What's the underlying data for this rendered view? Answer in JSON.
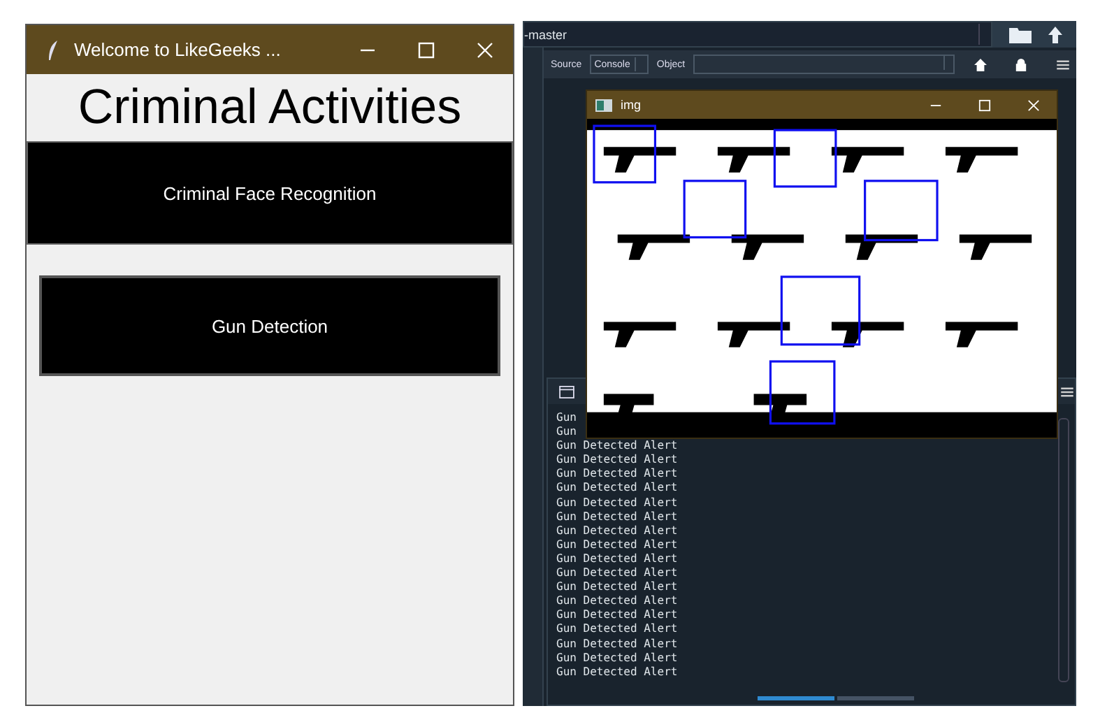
{
  "app_window": {
    "title": "Welcome to LikeGeeks ...",
    "heading": "Criminal Activities",
    "buttons": [
      {
        "label": "Criminal Face Recognition",
        "kind": "banner"
      },
      {
        "label": "Gun Detection",
        "kind": "bordered"
      }
    ]
  },
  "ide": {
    "path": "-master",
    "toolbar": {
      "source_label": "Source",
      "source_value": "Console",
      "object_label": "Object"
    },
    "console_lines": [
      "Gun",
      "Gun",
      "Gun Detected Alert",
      "Gun Detected Alert",
      "Gun Detected Alert",
      "Gun Detected Alert",
      "Gun Detected Alert",
      "Gun Detected Alert",
      "Gun Detected Alert",
      "Gun Detected Alert",
      "Gun Detected Alert",
      "Gun Detected Alert",
      "Gun Detected Alert",
      "Gun Detected Alert",
      "Gun Detected Alert",
      "Gun Detected Alert",
      "Gun Detected Alert",
      "Gun Detected Alert",
      "Gun Detected Alert"
    ]
  },
  "image_window": {
    "title": "img"
  }
}
